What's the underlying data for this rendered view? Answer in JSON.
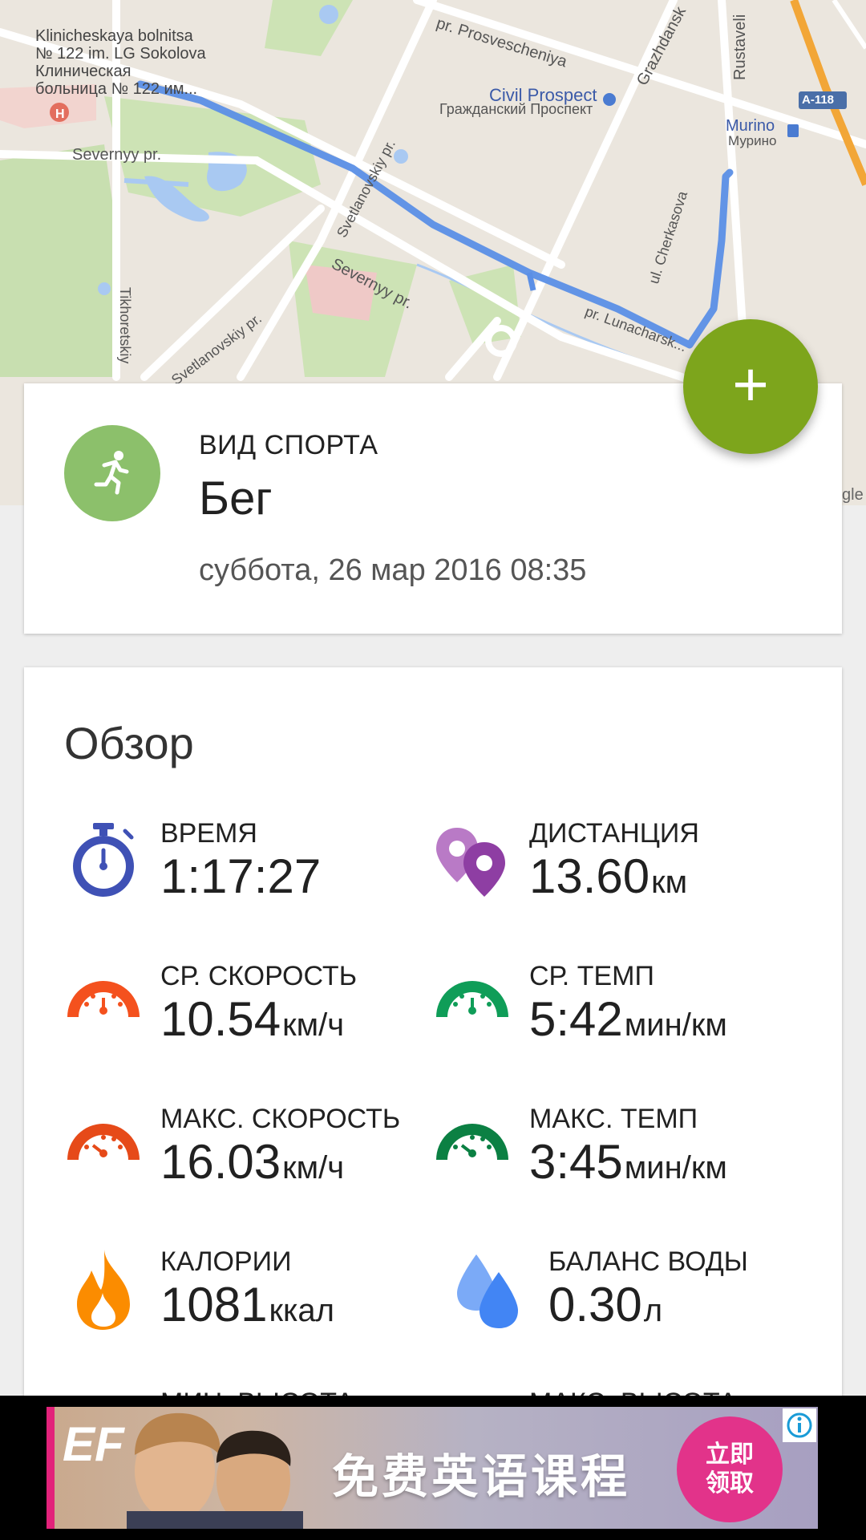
{
  "map": {
    "labels": {
      "hospital_en": "Klinicheskaya bolnitsa",
      "hospital_en2": "№ 122 im. LG Sokolova",
      "hospital_ru": "Клиническая",
      "hospital_ru2": "больница № 122 им...",
      "prosvescheniya": "pr. Prosvescheniya",
      "grazhdansk": "Grazhdansk",
      "rustaveli": "Rustaveli",
      "civil_prospect": "Civil Prospect",
      "civil_prospect_ru": "Гражданский Проспект",
      "murino": "Murino",
      "murino_ru": "Мурино",
      "road_badge": "A-118",
      "severnyy1": "Severnyy pr.",
      "severnyy2": "Severnyy pr.",
      "svetlanovskiy1": "Svetlanovskiy pr.",
      "svetlanovskiy2": "Svetlanovskiy pr.",
      "tikhoretskiy": "Tikhoretskiy",
      "cherkasova": "ul. Cherkasova",
      "lunacharskogo": "pr. Lunacharsk...",
      "google_partial": "gle"
    }
  },
  "fab": {
    "label": "+"
  },
  "sport": {
    "label": "ВИД СПОРТА",
    "value": "Бег",
    "date": "суббота, 26 мар 2016 08:35"
  },
  "overview": {
    "title": "Обзор",
    "stats": {
      "time": {
        "label": "ВРЕМЯ",
        "value": "1:17:27",
        "unit": ""
      },
      "distance": {
        "label": "ДИСТАНЦИЯ",
        "value": "13.60",
        "unit": "км"
      },
      "avg_speed": {
        "label": "СР. СКОРОСТЬ",
        "value": "10.54",
        "unit": "км/ч"
      },
      "avg_pace": {
        "label": "СР. ТЕМП",
        "value": "5:42",
        "unit": "мин/км"
      },
      "max_speed": {
        "label": "МАКС. СКОРОСТЬ",
        "value": "16.03",
        "unit": "км/ч"
      },
      "max_pace": {
        "label": "МАКС. ТЕМП",
        "value": "3:45",
        "unit": "мин/км"
      },
      "calories": {
        "label": "КАЛОРИИ",
        "value": "1081",
        "unit": "ккал"
      },
      "water": {
        "label": "БАЛАНС ВОДЫ",
        "value": "0.30",
        "unit": "л"
      },
      "min_alt": {
        "label": "МИН. ВЫСОТА"
      },
      "max_alt": {
        "label": "МАКС. ВЫСОТА"
      }
    }
  },
  "ad": {
    "logo": "EF",
    "text": "免费英语课程",
    "cta_line1": "立即",
    "cta_line2": "领取",
    "info": "i"
  },
  "colors": {
    "fab": "#7da51c",
    "sport_icon": "#8cc06b",
    "time_icon": "#3f51b5",
    "distance_icon": "#8e3ea3",
    "speed_icon": "#f4511e",
    "pace_icon": "#0f9d58",
    "max_speed_icon": "#e64a19",
    "max_pace_icon": "#0b8043",
    "calories_icon": "#fb8c00",
    "water_icon": "#4285f4",
    "route": "#5b8fe6"
  }
}
